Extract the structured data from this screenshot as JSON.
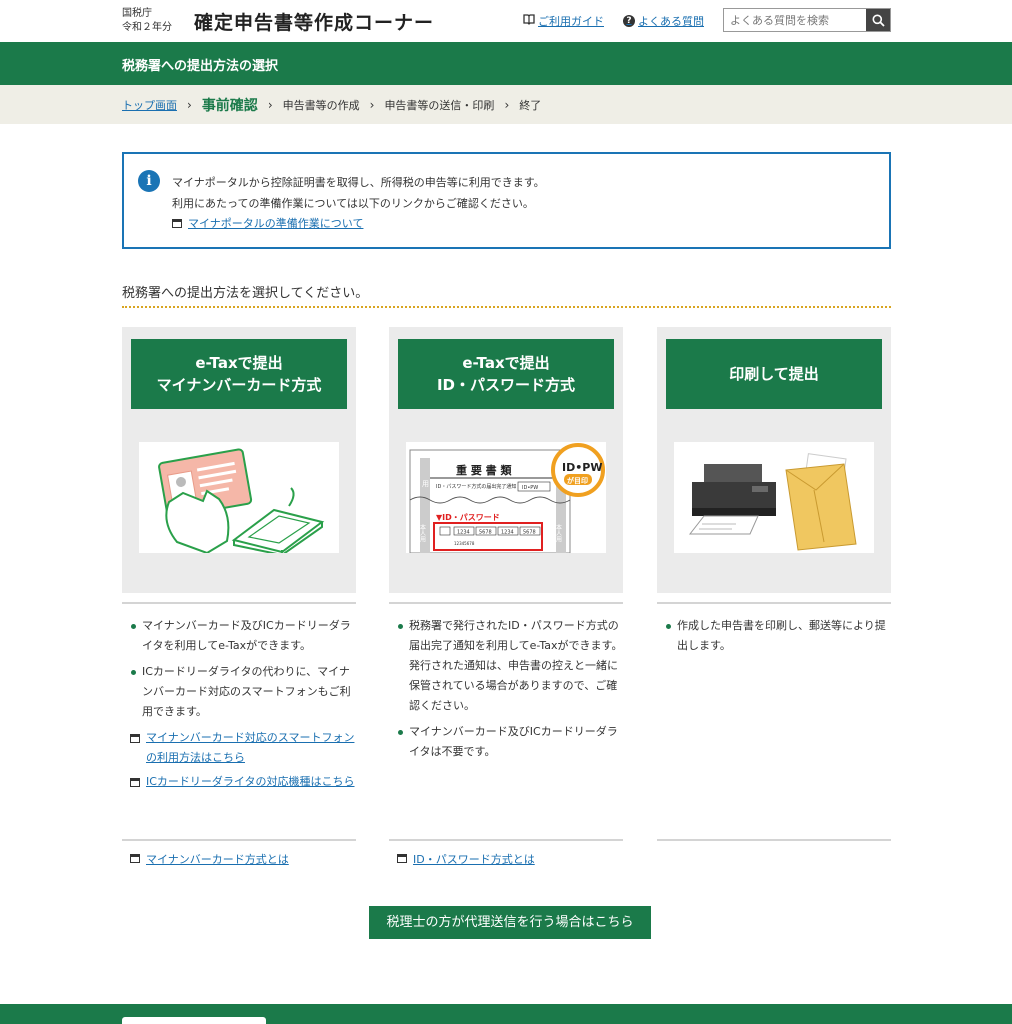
{
  "header": {
    "agency_line1": "国税庁",
    "agency_line2": "令和２年分",
    "title": "確定申告書等作成コーナー",
    "guide_link": "ご利用ガイド",
    "faq_link": "よくある質問",
    "search_placeholder": "よくある質問を検索"
  },
  "page_title": "税務署への提出方法の選択",
  "breadcrumb": {
    "top": "トップ画面",
    "current": "事前確認",
    "step2": "申告書等の作成",
    "step3": "申告書等の送信・印刷",
    "step4": "終了",
    "sep": "›"
  },
  "info": {
    "line1": "マイナポータルから控除証明書を取得し、所得税の申告等に利用できます。",
    "line2": "利用にあたっての準備作業については以下のリンクからご確認ください。",
    "link": "マイナポータルの準備作業について"
  },
  "prompt": "税務署への提出方法を選択してください。",
  "cards": [
    {
      "title_line1": "e-Taxで提出",
      "title_line2": "マイナンバーカード方式",
      "bullets": [
        "マイナンバーカード及びICカードリーダライタを利用してe-Taxができます。",
        "ICカードリーダライタの代わりに、マイナンバーカード対応のスマートフォンもご利用できます。"
      ],
      "links": [
        "マイナンバーカード対応のスマートフォンの利用方法はこちら",
        "ICカードリーダライタの対応機種はこちら"
      ],
      "bottom_link": "マイナンバーカード方式とは"
    },
    {
      "title_line1": "e-Taxで提出",
      "title_line2": "ID・パスワード方式",
      "image_text": {
        "doc_title": "重 要 書 類",
        "badge_line1": "ID•PW",
        "badge_line2": "が目印",
        "doc_sub": "ID・パスワード方式の届出完了通知",
        "id_pw_tag": "ID•PW",
        "pw_label": "▼ID・パスワード",
        "codes": [
          "1234",
          "5678",
          "1234",
          "5678"
        ],
        "serial": "12345678",
        "stamp_left": "用",
        "stamp_right": "本人用",
        "stamp_left2": "本人用"
      },
      "bullets": [
        "税務署で発行されたID・パスワード方式の届出完了通知を利用してe-Taxができます。"
      ],
      "sub_text": "発行された通知は、申告書の控えと一緒に保管されている場合がありますので、ご確認ください。",
      "bullets2": [
        "マイナンバーカード及びICカードリーダライタは不要です。"
      ],
      "bottom_link": "ID・パスワード方式とは"
    },
    {
      "title_line1": "印刷して提出",
      "bullets": [
        "作成した申告書を印刷し、郵送等により提出します。"
      ]
    }
  ],
  "agent_button": "税理士の方が代理送信を行う場合はこちら",
  "colors": {
    "primary_green": "#1b7a4a",
    "link_blue": "#1a6fb0",
    "info_border": "#1a74b5"
  }
}
